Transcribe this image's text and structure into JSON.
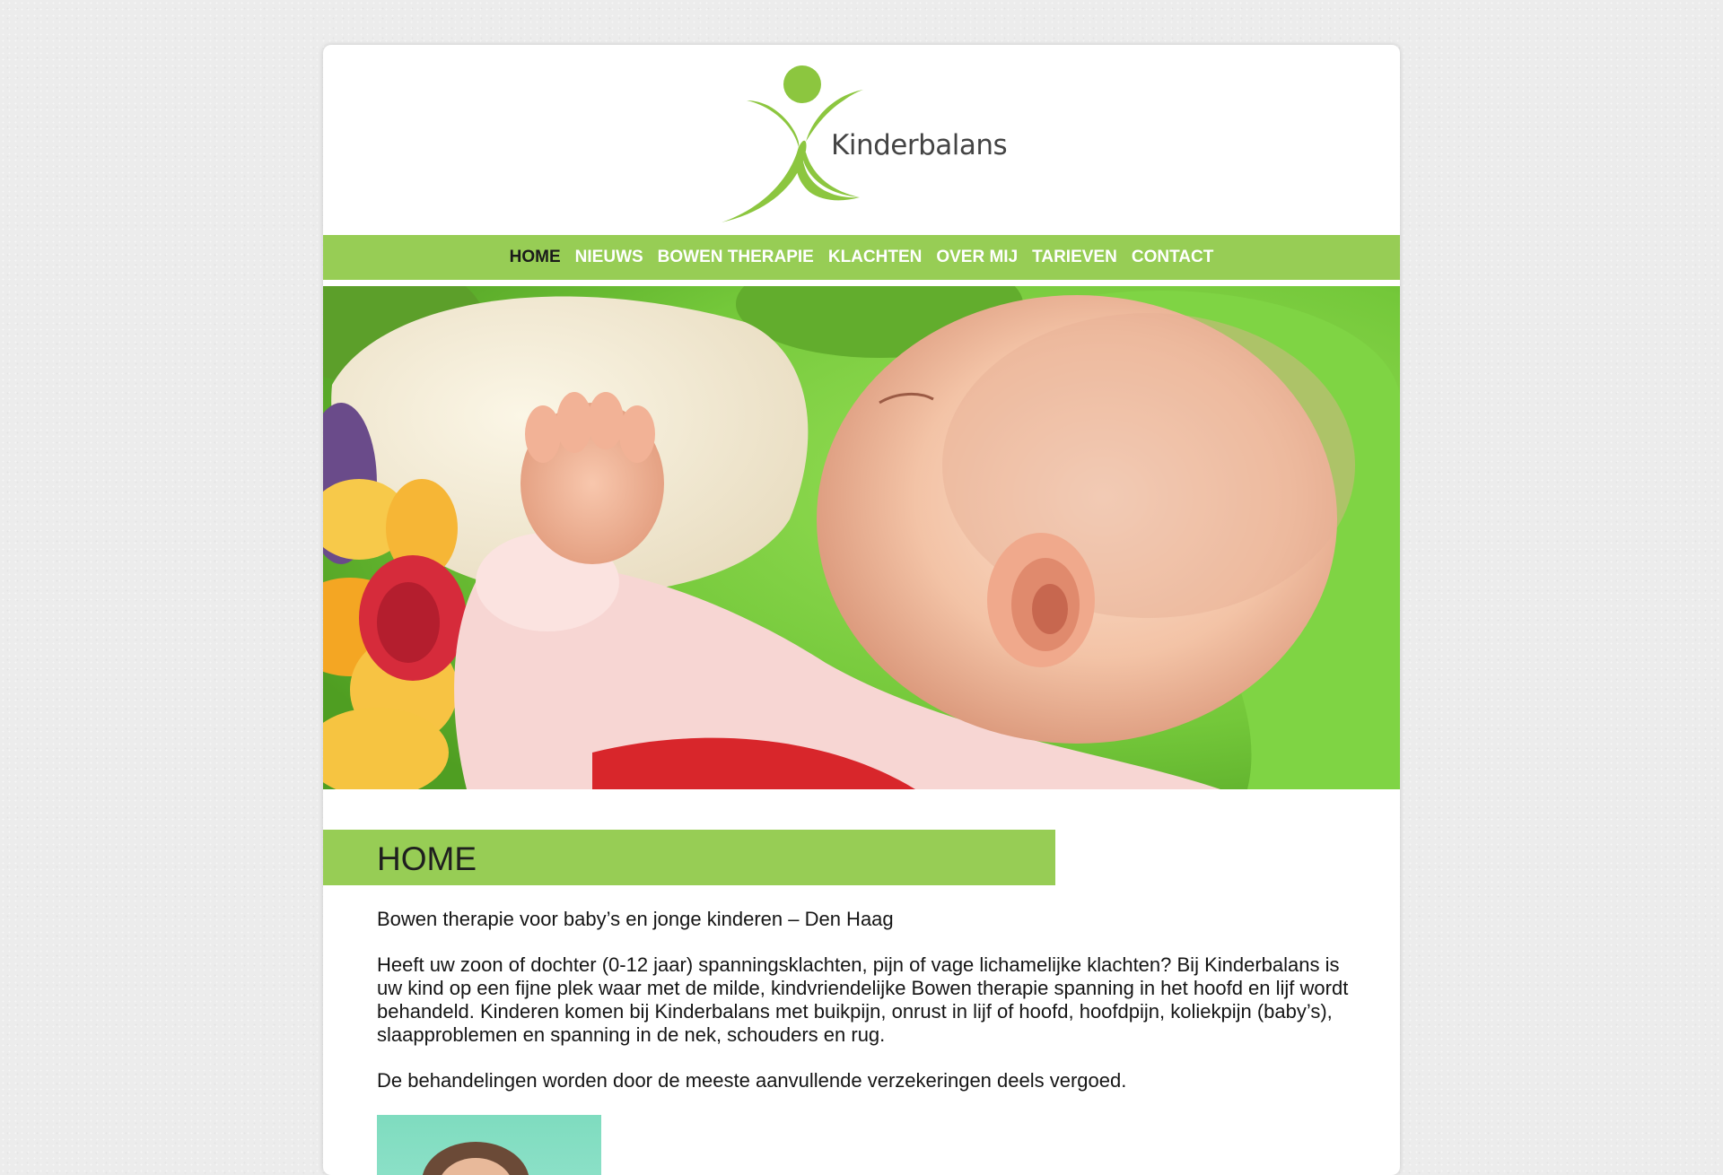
{
  "brand": {
    "name": "Kinderbalans",
    "accent_color": "#97cd55",
    "logo_icon": "person-figure-icon"
  },
  "nav": {
    "items": [
      {
        "label": "HOME",
        "active": true
      },
      {
        "label": "NIEUWS",
        "active": false
      },
      {
        "label": "BOWEN THERAPIE",
        "active": false
      },
      {
        "label": "KLACHTEN",
        "active": false
      },
      {
        "label": "OVER MIJ",
        "active": false
      },
      {
        "label": "TARIEVEN",
        "active": false
      },
      {
        "label": "CONTACT",
        "active": false
      }
    ]
  },
  "hero": {
    "image": "sleeping-baby-photo"
  },
  "main": {
    "title": "HOME",
    "paragraphs": [
      "Bowen therapie voor baby’s en jonge kinderen – Den Haag",
      "Heeft uw zoon of dochter (0-12 jaar) spanningsklachten, pijn of vage lichamelijke klachten? Bij Kinderbalans is uw kind op een fijne plek waar met de milde, kindvriendelijke Bowen therapie spanning in het hoofd en lijf wordt behandeld. Kinderen komen bij Kinderbalans met buikpijn, onrust in lijf of hoofd, hoofdpijn, koliekpijn (baby’s), slaapproblemen en spanning in de nek, schouders en rug.",
      "De behandelingen worden door de meeste aanvullende verzekeringen deels vergoed."
    ],
    "thumbnail": "portrait-photo"
  }
}
